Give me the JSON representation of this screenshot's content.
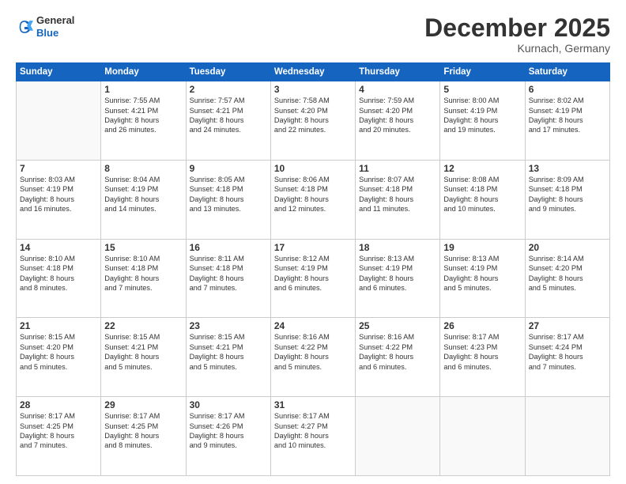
{
  "header": {
    "logo_general": "General",
    "logo_blue": "Blue",
    "month": "December 2025",
    "location": "Kurnach, Germany"
  },
  "weekdays": [
    "Sunday",
    "Monday",
    "Tuesday",
    "Wednesday",
    "Thursday",
    "Friday",
    "Saturday"
  ],
  "weeks": [
    [
      {
        "day": "",
        "info": ""
      },
      {
        "day": "1",
        "info": "Sunrise: 7:55 AM\nSunset: 4:21 PM\nDaylight: 8 hours\nand 26 minutes."
      },
      {
        "day": "2",
        "info": "Sunrise: 7:57 AM\nSunset: 4:21 PM\nDaylight: 8 hours\nand 24 minutes."
      },
      {
        "day": "3",
        "info": "Sunrise: 7:58 AM\nSunset: 4:20 PM\nDaylight: 8 hours\nand 22 minutes."
      },
      {
        "day": "4",
        "info": "Sunrise: 7:59 AM\nSunset: 4:20 PM\nDaylight: 8 hours\nand 20 minutes."
      },
      {
        "day": "5",
        "info": "Sunrise: 8:00 AM\nSunset: 4:19 PM\nDaylight: 8 hours\nand 19 minutes."
      },
      {
        "day": "6",
        "info": "Sunrise: 8:02 AM\nSunset: 4:19 PM\nDaylight: 8 hours\nand 17 minutes."
      }
    ],
    [
      {
        "day": "7",
        "info": "Sunrise: 8:03 AM\nSunset: 4:19 PM\nDaylight: 8 hours\nand 16 minutes."
      },
      {
        "day": "8",
        "info": "Sunrise: 8:04 AM\nSunset: 4:19 PM\nDaylight: 8 hours\nand 14 minutes."
      },
      {
        "day": "9",
        "info": "Sunrise: 8:05 AM\nSunset: 4:18 PM\nDaylight: 8 hours\nand 13 minutes."
      },
      {
        "day": "10",
        "info": "Sunrise: 8:06 AM\nSunset: 4:18 PM\nDaylight: 8 hours\nand 12 minutes."
      },
      {
        "day": "11",
        "info": "Sunrise: 8:07 AM\nSunset: 4:18 PM\nDaylight: 8 hours\nand 11 minutes."
      },
      {
        "day": "12",
        "info": "Sunrise: 8:08 AM\nSunset: 4:18 PM\nDaylight: 8 hours\nand 10 minutes."
      },
      {
        "day": "13",
        "info": "Sunrise: 8:09 AM\nSunset: 4:18 PM\nDaylight: 8 hours\nand 9 minutes."
      }
    ],
    [
      {
        "day": "14",
        "info": "Sunrise: 8:10 AM\nSunset: 4:18 PM\nDaylight: 8 hours\nand 8 minutes."
      },
      {
        "day": "15",
        "info": "Sunrise: 8:10 AM\nSunset: 4:18 PM\nDaylight: 8 hours\nand 7 minutes."
      },
      {
        "day": "16",
        "info": "Sunrise: 8:11 AM\nSunset: 4:18 PM\nDaylight: 8 hours\nand 7 minutes."
      },
      {
        "day": "17",
        "info": "Sunrise: 8:12 AM\nSunset: 4:19 PM\nDaylight: 8 hours\nand 6 minutes."
      },
      {
        "day": "18",
        "info": "Sunrise: 8:13 AM\nSunset: 4:19 PM\nDaylight: 8 hours\nand 6 minutes."
      },
      {
        "day": "19",
        "info": "Sunrise: 8:13 AM\nSunset: 4:19 PM\nDaylight: 8 hours\nand 5 minutes."
      },
      {
        "day": "20",
        "info": "Sunrise: 8:14 AM\nSunset: 4:20 PM\nDaylight: 8 hours\nand 5 minutes."
      }
    ],
    [
      {
        "day": "21",
        "info": "Sunrise: 8:15 AM\nSunset: 4:20 PM\nDaylight: 8 hours\nand 5 minutes."
      },
      {
        "day": "22",
        "info": "Sunrise: 8:15 AM\nSunset: 4:21 PM\nDaylight: 8 hours\nand 5 minutes."
      },
      {
        "day": "23",
        "info": "Sunrise: 8:15 AM\nSunset: 4:21 PM\nDaylight: 8 hours\nand 5 minutes."
      },
      {
        "day": "24",
        "info": "Sunrise: 8:16 AM\nSunset: 4:22 PM\nDaylight: 8 hours\nand 5 minutes."
      },
      {
        "day": "25",
        "info": "Sunrise: 8:16 AM\nSunset: 4:22 PM\nDaylight: 8 hours\nand 6 minutes."
      },
      {
        "day": "26",
        "info": "Sunrise: 8:17 AM\nSunset: 4:23 PM\nDaylight: 8 hours\nand 6 minutes."
      },
      {
        "day": "27",
        "info": "Sunrise: 8:17 AM\nSunset: 4:24 PM\nDaylight: 8 hours\nand 7 minutes."
      }
    ],
    [
      {
        "day": "28",
        "info": "Sunrise: 8:17 AM\nSunset: 4:25 PM\nDaylight: 8 hours\nand 7 minutes."
      },
      {
        "day": "29",
        "info": "Sunrise: 8:17 AM\nSunset: 4:25 PM\nDaylight: 8 hours\nand 8 minutes."
      },
      {
        "day": "30",
        "info": "Sunrise: 8:17 AM\nSunset: 4:26 PM\nDaylight: 8 hours\nand 9 minutes."
      },
      {
        "day": "31",
        "info": "Sunrise: 8:17 AM\nSunset: 4:27 PM\nDaylight: 8 hours\nand 10 minutes."
      },
      {
        "day": "",
        "info": ""
      },
      {
        "day": "",
        "info": ""
      },
      {
        "day": "",
        "info": ""
      }
    ]
  ]
}
